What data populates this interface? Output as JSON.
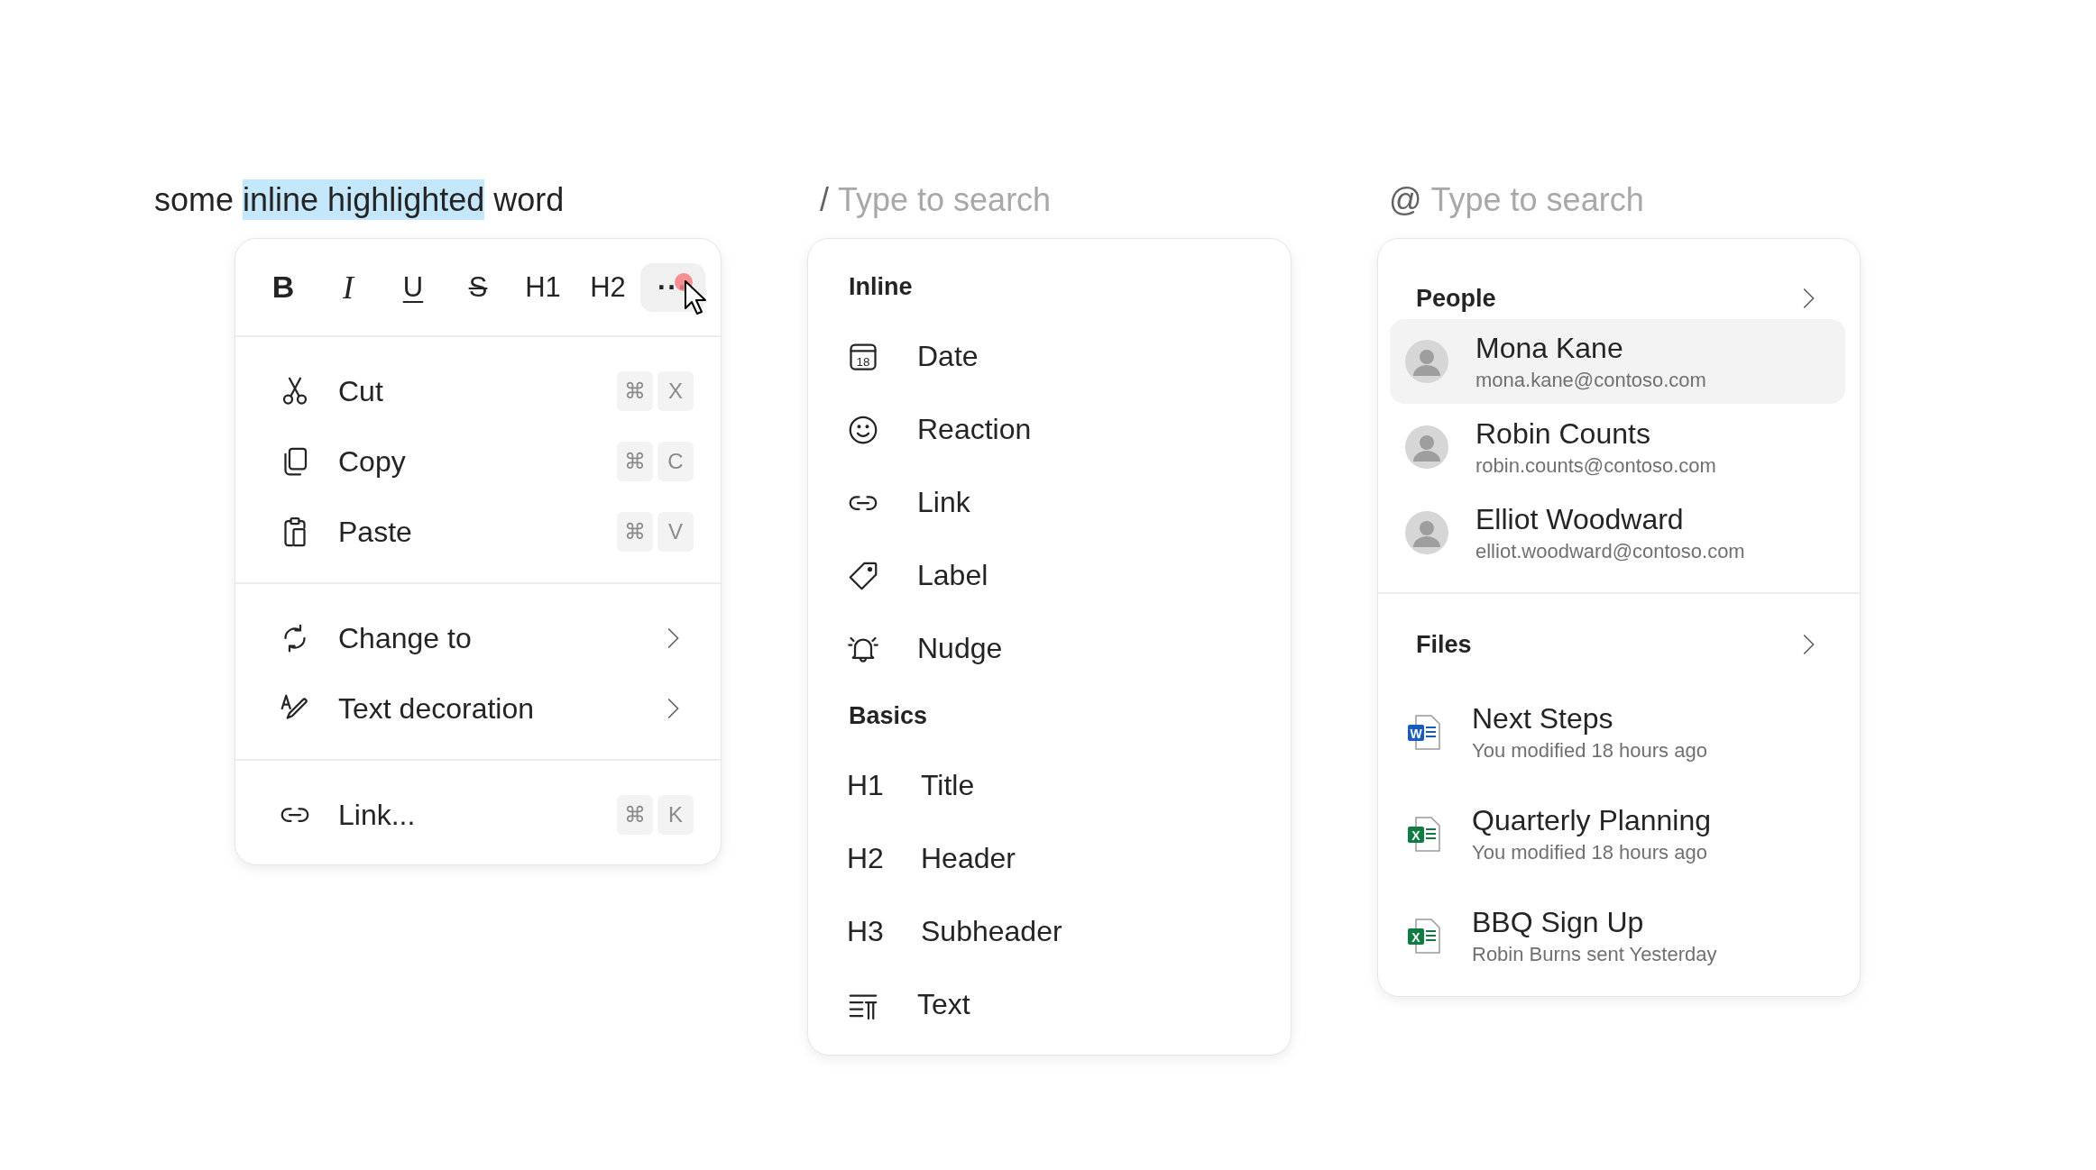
{
  "editor_line": {
    "segments": [
      {
        "text": "some ",
        "highlighted": false
      },
      {
        "text": "inline highlighted",
        "highlighted": true
      },
      {
        "text": " word",
        "highlighted": false
      }
    ]
  },
  "format_menu": {
    "toolbar": [
      {
        "kind": "bold",
        "label": "B",
        "selected": false
      },
      {
        "kind": "italic",
        "label": "I",
        "selected": false
      },
      {
        "kind": "underline",
        "label": "U",
        "selected": false
      },
      {
        "kind": "strike",
        "label": "S",
        "selected": false
      },
      {
        "kind": "heading",
        "label": "H1",
        "selected": false
      },
      {
        "kind": "heading",
        "label": "H2",
        "selected": false
      },
      {
        "kind": "more",
        "label": "···",
        "selected": true
      }
    ],
    "groups": [
      {
        "items": [
          {
            "label": "Cut",
            "keys": [
              "⌘",
              "X"
            ],
            "submenu": false
          },
          {
            "label": "Copy",
            "keys": [
              "⌘",
              "C"
            ],
            "submenu": false
          },
          {
            "label": "Paste",
            "keys": [
              "⌘",
              "V"
            ],
            "submenu": false
          }
        ]
      },
      {
        "items": [
          {
            "label": "Change to",
            "submenu": true
          },
          {
            "label": "Text decoration",
            "submenu": true
          }
        ]
      },
      {
        "items": [
          {
            "label": "Link...",
            "keys": [
              "⌘",
              "K"
            ],
            "submenu": false
          }
        ]
      }
    ]
  },
  "slash_menu": {
    "search": {
      "prefix": "/",
      "placeholder": "Type to search"
    },
    "sections": [
      {
        "title": "Inline",
        "items": [
          {
            "kind": "icon",
            "icon_text": "18",
            "label": "Date"
          },
          {
            "kind": "icon",
            "label": "Reaction"
          },
          {
            "kind": "icon",
            "label": "Link"
          },
          {
            "kind": "icon",
            "label": "Label"
          },
          {
            "kind": "icon",
            "label": "Nudge"
          }
        ]
      },
      {
        "title": "Basics",
        "items": [
          {
            "kind": "glyph",
            "glyph": "H1",
            "label": "Title"
          },
          {
            "kind": "glyph",
            "glyph": "H2",
            "label": "Header"
          },
          {
            "kind": "glyph",
            "glyph": "H3",
            "label": "Subheader"
          },
          {
            "kind": "icon",
            "label": "Text"
          }
        ]
      }
    ]
  },
  "mention_menu": {
    "search": {
      "prefix": "@",
      "placeholder": "Type to search"
    },
    "people": {
      "title": "People",
      "items": [
        {
          "name": "Mona Kane",
          "email": "mona.kane@contoso.com",
          "selected": true
        },
        {
          "name": "Robin Counts",
          "email": "robin.counts@contoso.com",
          "selected": false
        },
        {
          "name": "Elliot Woodward",
          "email": "elliot.woodward@contoso.com",
          "selected": false
        }
      ]
    },
    "files": {
      "title": "Files",
      "items": [
        {
          "kind": "word",
          "badge": "W",
          "name": "Next Steps",
          "detail": "You modified 18 hours ago"
        },
        {
          "kind": "excel",
          "badge": "X",
          "name": "Quarterly Planning",
          "detail": "You modified 18 hours ago"
        },
        {
          "kind": "excel",
          "badge": "X",
          "name": "BBQ Sign Up",
          "detail": "Robin Burns sent Yesterday"
        }
      ]
    }
  }
}
